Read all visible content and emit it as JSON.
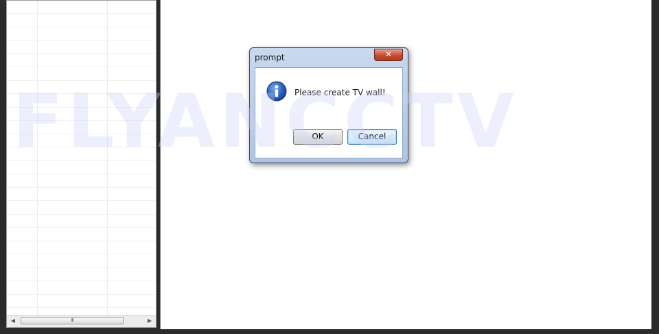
{
  "dialog": {
    "title": "prompt",
    "close_label": "✕",
    "message": "Please create TV wall!",
    "ok_label": "OK",
    "cancel_label": "Cancel",
    "icon": "info-icon"
  },
  "watermark": {
    "text": "FLYANCCTV"
  },
  "left_panel": {
    "scroll_grip": "III"
  },
  "colors": {
    "accent": "#3c7fb1",
    "close_red": "#c74a31",
    "frame": "#2b2b2b",
    "info_blue": "#1e4fa8"
  }
}
